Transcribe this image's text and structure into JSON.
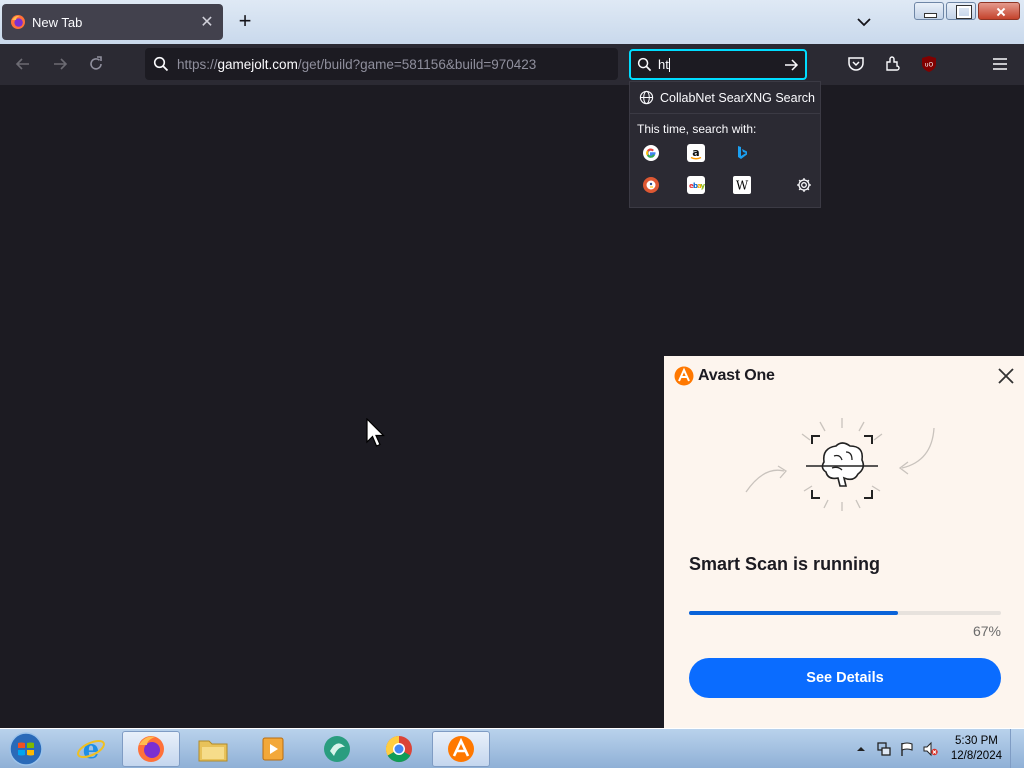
{
  "browser": {
    "tab_title": "New Tab",
    "url_prefix": "https://",
    "url_host": "gamejolt.com",
    "url_path": "/get/build?game=581156&build=970423",
    "search_value": "ht"
  },
  "search_dropdown": {
    "engine_result": "CollabNet SearXNG Search",
    "this_time_label": "This time, search with:",
    "engines": [
      "Google",
      "Amazon",
      "Bing",
      "DuckDuckGo",
      "eBay",
      "Wikipedia"
    ]
  },
  "avast": {
    "brand": "Avast One",
    "status": "Smart Scan is running",
    "progress_percent": 67,
    "progress_label": "67%",
    "details_button": "See Details",
    "accent": "#0a6cff"
  },
  "taskbar": {
    "apps": [
      "Internet Explorer",
      "Firefox",
      "File Explorer",
      "Media Player",
      "App",
      "Chrome",
      "Avast"
    ],
    "time": "5:30 PM",
    "date": "12/8/2024"
  },
  "colors": {
    "toolbar": "#2b2a33",
    "content": "#1c1b22",
    "focus_ring": "#00ddff"
  }
}
